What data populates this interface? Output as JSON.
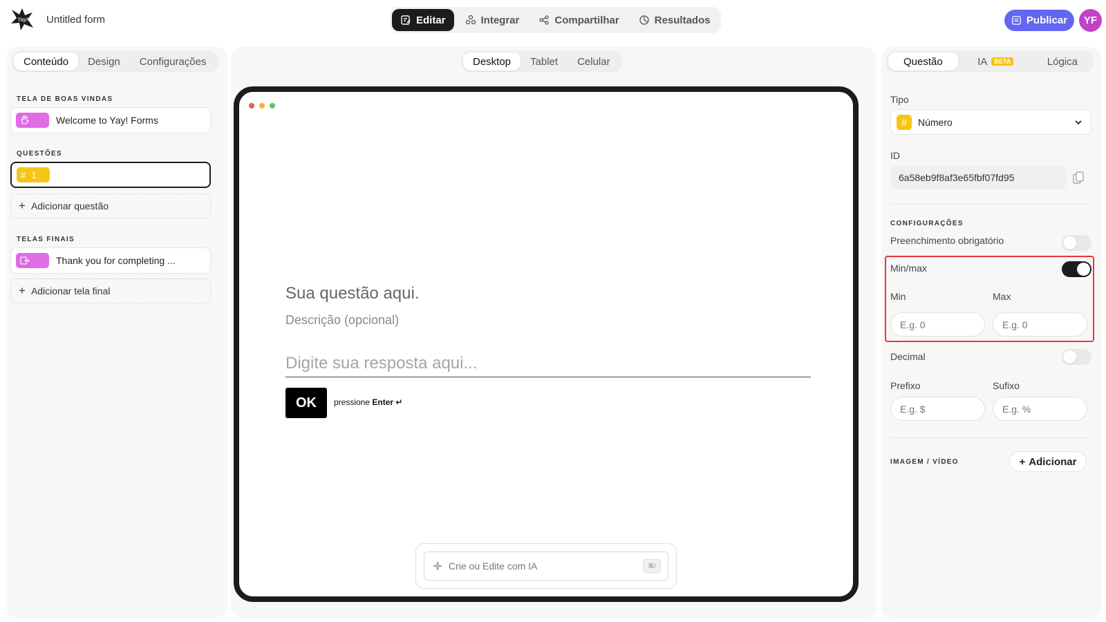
{
  "header": {
    "form_title": "Untitled form",
    "nav": [
      {
        "label": "Editar",
        "icon": "edit-icon"
      },
      {
        "label": "Integrar",
        "icon": "integrate-icon"
      },
      {
        "label": "Compartilhar",
        "icon": "share-icon"
      },
      {
        "label": "Resultados",
        "icon": "results-icon"
      }
    ],
    "active_nav": "Editar",
    "publish_label": "Publicar",
    "avatar_initials": "YF"
  },
  "left_panel": {
    "tabs": [
      "Conteúdo",
      "Design",
      "Configurações"
    ],
    "active_tab": "Conteúdo",
    "welcome_section": "TELA DE BOAS VINDAS",
    "welcome_item": "Welcome to Yay! Forms",
    "questions_section": "QUESTÕES",
    "question_number": "1",
    "add_question_label": "Adicionar questão",
    "endings_section": "TELAS FINAIS",
    "ending_item": "Thank you for completing ...",
    "add_ending_label": "Adicionar tela final"
  },
  "center_panel": {
    "device_tabs": [
      "Desktop",
      "Tablet",
      "Celular"
    ],
    "active_device": "Desktop",
    "question_title": "Sua questão aqui.",
    "question_description": "Descrição (opcional)",
    "answer_placeholder": "Digite sua resposta aqui...",
    "ok_label": "OK",
    "enter_hint_prefix": "pressione",
    "enter_hint_key": "Enter ↵",
    "ai_placeholder": "Crie ou Edite com IA",
    "ai_shortcut": "⌘/"
  },
  "right_panel": {
    "tabs": [
      "Questão",
      "IA",
      "Lógica"
    ],
    "beta_badge": "BETA",
    "active_tab": "Questão",
    "type_label": "Tipo",
    "type_value": "Número",
    "id_label": "ID",
    "id_value": "6a58eb9f8af3e65fbf07fd95",
    "settings_section": "CONFIGURAÇÕES",
    "required_label": "Preenchimento obrigatório",
    "required_on": false,
    "minmax_label": "Min/max",
    "minmax_on": true,
    "min_label": "Min",
    "min_placeholder": "E.g. 0",
    "max_label": "Max",
    "max_placeholder": "E.g. 0",
    "decimal_label": "Decimal",
    "decimal_on": false,
    "prefix_label": "Prefixo",
    "prefix_placeholder": "E.g. $",
    "suffix_label": "Sufixo",
    "suffix_placeholder": "E.g. %",
    "media_section": "IMAGEM / VÍDEO",
    "add_media_label": "Adicionar"
  },
  "colors": {
    "accent": "#6366f1",
    "avatar": "#c043c6",
    "number_type": "#f5c518",
    "screen_type": "#e06ce6",
    "highlight": "#e53935"
  }
}
